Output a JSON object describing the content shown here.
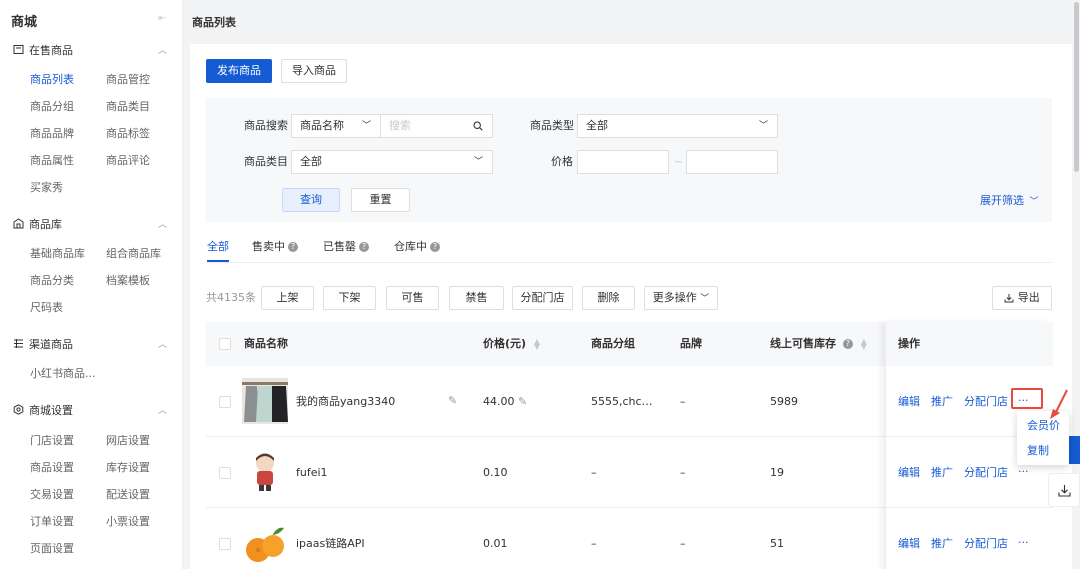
{
  "sidebar": {
    "title": "商城",
    "collapse_icon": "collapse-left-icon",
    "groups": [
      {
        "label": "在售商品",
        "icon": "store-icon",
        "items": [
          {
            "label": "商品列表",
            "active": true
          },
          {
            "label": "商品管控"
          },
          {
            "label": "商品分组"
          },
          {
            "label": "商品类目"
          },
          {
            "label": "商品品牌"
          },
          {
            "label": "商品标签"
          },
          {
            "label": "商品属性"
          },
          {
            "label": "商品评论"
          },
          {
            "label": "买家秀"
          }
        ]
      },
      {
        "label": "商品库",
        "icon": "library-icon",
        "items": [
          {
            "label": "基础商品库"
          },
          {
            "label": "组合商品库"
          },
          {
            "label": "商品分类"
          },
          {
            "label": "档案模板"
          },
          {
            "label": "尺码表"
          }
        ]
      },
      {
        "label": "渠道商品",
        "icon": "channel-icon",
        "items": [
          {
            "label": "小红书商品..."
          }
        ]
      },
      {
        "label": "商城设置",
        "icon": "settings-icon",
        "items": [
          {
            "label": "门店设置"
          },
          {
            "label": "网店设置"
          },
          {
            "label": "商品设置"
          },
          {
            "label": "库存设置"
          },
          {
            "label": "交易设置"
          },
          {
            "label": "配送设置"
          },
          {
            "label": "订单设置"
          },
          {
            "label": "小票设置"
          },
          {
            "label": "页面设置"
          }
        ]
      }
    ]
  },
  "page": {
    "title": "商品列表"
  },
  "actions": {
    "publish": "发布商品",
    "import": "导入商品"
  },
  "filter": {
    "search_label": "商品搜索",
    "search_field_select": "商品名称",
    "search_placeholder": "搜索",
    "type_label": "商品类型",
    "type_value": "全部",
    "category_label": "商品类目",
    "category_value": "全部",
    "price_label": "价格",
    "price_separator": "~",
    "query_button": "查询",
    "reset_button": "重置",
    "expand_link": "展开筛选"
  },
  "tabs": [
    {
      "label": "全部",
      "active": true,
      "help": false
    },
    {
      "label": "售卖中",
      "help": true
    },
    {
      "label": "已售罄",
      "help": true
    },
    {
      "label": "仓库中",
      "help": true
    }
  ],
  "toolbar": {
    "total": "共4135条",
    "buttons": [
      "上架",
      "下架",
      "可售",
      "禁售",
      "分配门店",
      "删除"
    ],
    "more": "更多操作",
    "export": "导出"
  },
  "table": {
    "columns": {
      "name": "商品名称",
      "price": "价格(元)",
      "group": "商品分组",
      "brand": "品牌",
      "stock": "线上可售库存",
      "ops": "操作"
    },
    "rows": [
      {
        "name": "我的商品yang3340",
        "price": "44.00",
        "group": "5555,chc…",
        "brand": "–",
        "stock": "5989",
        "thumb": "clothes"
      },
      {
        "name": "fufei1",
        "price": "0.10",
        "group": "–",
        "brand": "–",
        "stock": "19",
        "thumb": "cartoon"
      },
      {
        "name": "ipaas链路API",
        "price": "0.01",
        "group": "–",
        "brand": "–",
        "stock": "51",
        "thumb": "orange"
      }
    ],
    "row_actions": [
      "编辑",
      "推广",
      "分配门店",
      "···"
    ]
  },
  "more_menu": {
    "items": [
      "会员价",
      "复制"
    ]
  },
  "colors": {
    "accent": "#155bd4",
    "highlight": "#e64a3a"
  }
}
